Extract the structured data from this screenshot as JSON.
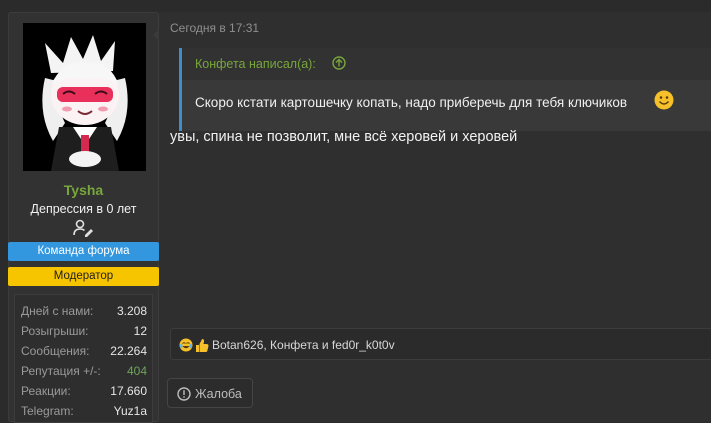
{
  "user": {
    "name": "Tysha",
    "title": "Депрессия в 0 лет",
    "banners": [
      "Команда форума",
      "Модератор"
    ],
    "colors": {
      "name": "#78a63c",
      "team_banner": "#3297df",
      "mod_banner": "#f7c400"
    },
    "stats": [
      {
        "label": "Дней с нами:",
        "value": "3.208"
      },
      {
        "label": "Розыгрыши:",
        "value": "12"
      },
      {
        "label": "Сообщения:",
        "value": "22.264"
      },
      {
        "label": "Репутация +/-:",
        "value": "404"
      },
      {
        "label": "Реакции:",
        "value": "17.660"
      },
      {
        "label": "Telegram:",
        "value": "Yuz1a"
      }
    ]
  },
  "post": {
    "date": "Сегодня в 17:31",
    "quote": {
      "author": "Конфета написал(а):",
      "text": "Скоро кстати картошечку копать, надо приберечь для тебя ключиков",
      "accent": "#3b8fd1"
    },
    "message": "увы, спина не позволит, мне всё херовей и херовей",
    "reactions": {
      "icons": [
        "laugh-cry-emoji",
        "thumbs-up-emoji"
      ],
      "users": "Botan626, Конфета и fed0r_k0t0v"
    },
    "report_label": "Жалоба"
  }
}
